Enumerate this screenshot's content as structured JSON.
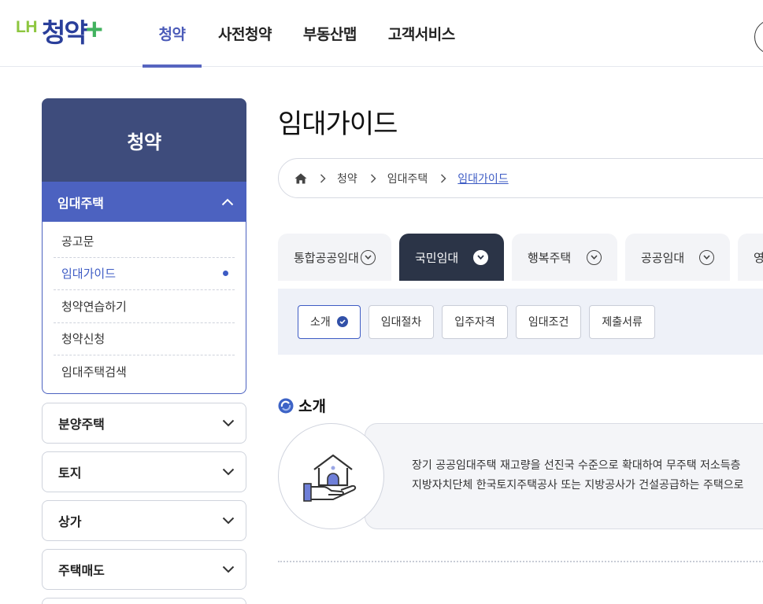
{
  "header": {
    "logo_lh": "LH",
    "logo_main": "청약",
    "logo_plus": "+",
    "nav": [
      "청약",
      "사전청약",
      "부동산맵",
      "고객서비스"
    ]
  },
  "sidebar": {
    "title": "청약",
    "open_menu": {
      "label": "임대주택",
      "items": [
        "공고문",
        "임대가이드",
        "청약연습하기",
        "청약신청",
        "임대주택검색"
      ],
      "active_index": 1
    },
    "menus": [
      "분양주택",
      "토지",
      "상가",
      "주택매도"
    ]
  },
  "main": {
    "title": "임대가이드",
    "breadcrumb": [
      "청약",
      "임대주택",
      "임대가이드"
    ],
    "tabs": [
      "통합공공임대",
      "국민임대",
      "행복주택",
      "공공임대",
      "영"
    ],
    "active_tab": 1,
    "subtabs": [
      "소개",
      "임대절차",
      "입주자격",
      "임대조건",
      "제출서류"
    ],
    "active_subtab": 0,
    "section_title": "소개",
    "intro_lines": [
      "장기 공공임대주택 재고량을 선진국 수준으로 확대하여 무주택 저소득층",
      "지방자치단체 한국토지주택공사 또는 지방공사가 건설공급하는 주택으로"
    ]
  },
  "colors": {
    "brand_blue": "#2a3f9b",
    "brand_green": "#42b25f",
    "sidebar_head": "#3e4c7c",
    "sidebar_active": "#4c62c0",
    "tab_active": "#2b3447",
    "link": "#3d5bc4"
  }
}
